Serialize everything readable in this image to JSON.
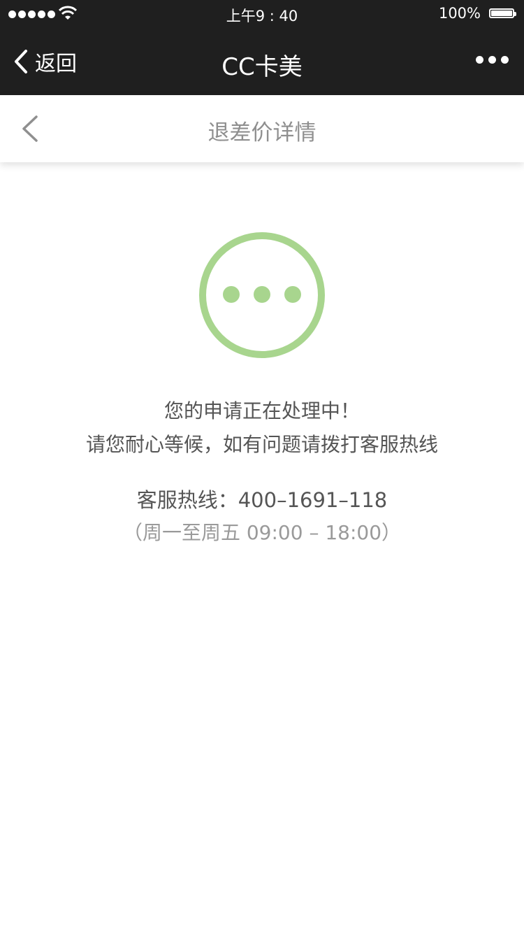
{
  "status_bar": {
    "time": "上午9 : 40",
    "battery_percent": "100%",
    "signal_bars": 5,
    "icons": [
      "signal-dots-icon",
      "wifi-icon",
      "battery-icon"
    ]
  },
  "navbar": {
    "back_label": "返回",
    "title": "CC卡美",
    "icons": [
      "chevron-left-icon",
      "more-icon"
    ]
  },
  "subheader": {
    "title": "退差价详情",
    "icons": [
      "chevron-left-icon"
    ]
  },
  "content": {
    "status_icon": "processing-icon",
    "accent_color": "#a8d58e",
    "message_line1": "您的申请正在处理中！",
    "message_line2": "请您耐心等候，如有问题请拨打客服热线",
    "hotline": "客服热线：400–1691–118",
    "hours": "（周一至周五 09:00 – 18:00）"
  }
}
